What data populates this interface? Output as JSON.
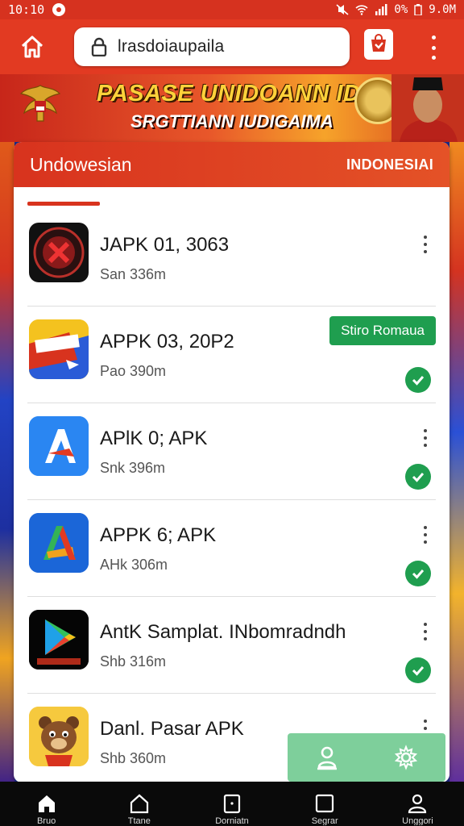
{
  "status_bar": {
    "time": "10:10",
    "battery": "0%",
    "right_text": "9.0M"
  },
  "browser": {
    "url": "lrasdoiaupaila"
  },
  "banner": {
    "title": "PASASE UNIDOANN IDONEH",
    "subtitle": "SRGTTIANN IUDIGAIMA"
  },
  "card": {
    "header_left": "Undowesian",
    "header_right": "INDONESIAI"
  },
  "apps": [
    {
      "name": "JAPK 01, 3063",
      "size": "San 336m",
      "icon": "game-icon",
      "has_menu": true,
      "checked": false,
      "badge": ""
    },
    {
      "name": "APPK 03, 20P2",
      "size": "Pao 390m",
      "icon": "pasar-icon",
      "has_menu": false,
      "checked": true,
      "badge": "Stiro Romaua"
    },
    {
      "name": "APlK 0; APK",
      "size": "Snk 396m",
      "icon": "appstore-blue-icon",
      "has_menu": true,
      "checked": true,
      "badge": ""
    },
    {
      "name": "APPK 6; APK",
      "size": "AHk 306m",
      "icon": "appstore-gradient-icon",
      "has_menu": true,
      "checked": true,
      "badge": ""
    },
    {
      "name": "AntK Samplat. INbomradndh",
      "size": "Shb 316m",
      "icon": "play-store-icon",
      "has_menu": true,
      "checked": true,
      "badge": ""
    },
    {
      "name": "Danl. Pasar APK",
      "size": "Shb 360m",
      "icon": "bear-mascot-icon",
      "has_menu": true,
      "checked": false,
      "badge": ""
    }
  ],
  "bottom_nav": [
    {
      "label": "Bruo",
      "icon": "home-icon"
    },
    {
      "label": "Ttane",
      "icon": "home-outline-icon"
    },
    {
      "label": "Dorniatn",
      "icon": "tablet-icon"
    },
    {
      "label": "Segrar",
      "icon": "square-icon"
    },
    {
      "label": "Unggori",
      "icon": "person-icon"
    }
  ],
  "colors": {
    "primary": "#e23a22",
    "header": "#d8331e",
    "success": "#1f9e4f",
    "fab_panel": "#7ecf9b"
  }
}
